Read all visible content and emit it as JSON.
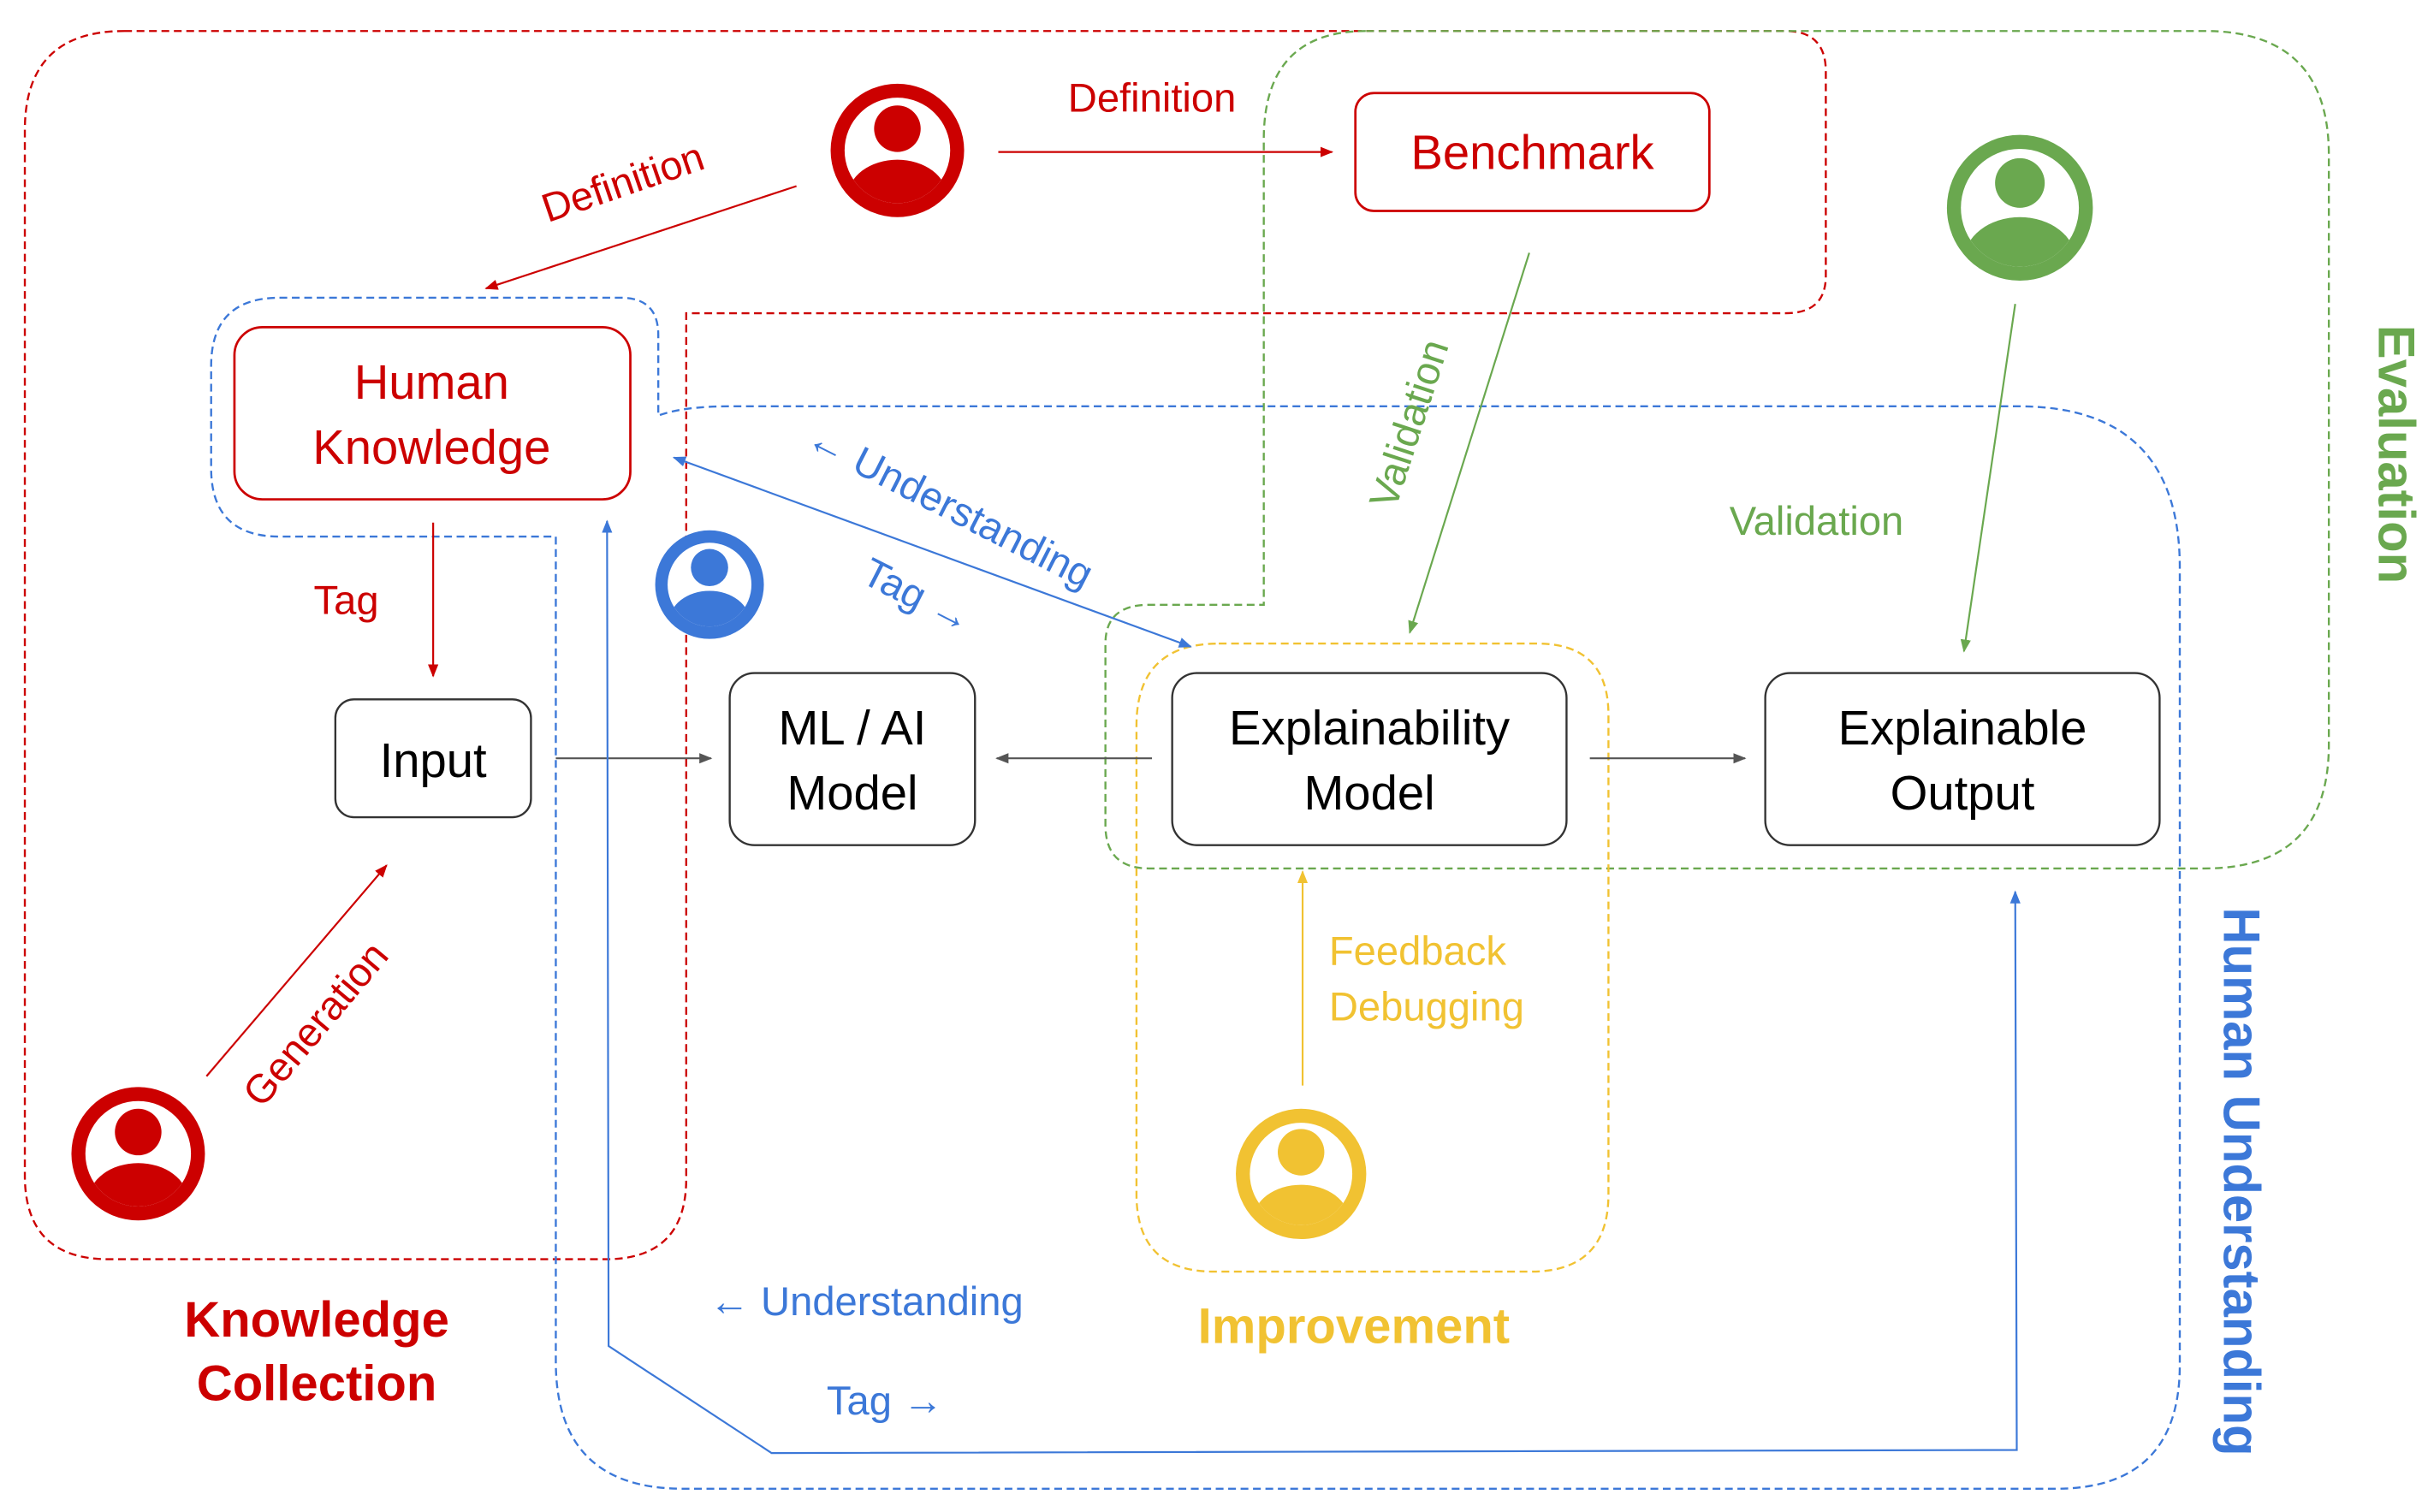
{
  "colors": {
    "red": "#cc0000",
    "green": "#6aa84f",
    "blue": "#3c78d8",
    "yellow": "#f1c232",
    "box_stroke": "#333333",
    "arrow_gray": "#555555"
  },
  "nodes": {
    "human_knowledge": {
      "line1": "Human",
      "line2": "Knowledge"
    },
    "benchmark": {
      "label": "Benchmark"
    },
    "input": {
      "label": "Input"
    },
    "ml_model": {
      "line1": "ML / AI",
      "line2": "Model"
    },
    "explainability_model": {
      "line1": "Explainability",
      "line2": "Model"
    },
    "explainable_output": {
      "line1": "Explainable",
      "line2": "Output"
    }
  },
  "edge_labels": {
    "definition_to_benchmark": "Definition",
    "definition_to_human_knowledge": "Definition",
    "tag_to_input": "Tag",
    "generation": "Generation",
    "understanding_diag": "← Understanding",
    "tag_diag": "Tag →",
    "validation_benchmark": "Validation",
    "validation_output": "Validation",
    "feedback": "Feedback",
    "debugging": "Debugging",
    "understanding_bottom": "← Understanding",
    "tag_bottom": "Tag →"
  },
  "groups": {
    "knowledge_collection": {
      "line1": "Knowledge",
      "line2": "Collection"
    },
    "evaluation": "Evaluation",
    "human_understanding": "Human Understanding",
    "improvement": "Improvement"
  },
  "actors": [
    {
      "name": "definer",
      "icon": "user-circle-icon",
      "color": "red"
    },
    {
      "name": "generator",
      "icon": "user-circle-icon",
      "color": "red"
    },
    {
      "name": "evaluator",
      "icon": "user-circle-icon",
      "color": "green"
    },
    {
      "name": "understander",
      "icon": "user-circle-icon",
      "color": "blue"
    },
    {
      "name": "improver",
      "icon": "user-circle-icon",
      "color": "yellow"
    }
  ]
}
